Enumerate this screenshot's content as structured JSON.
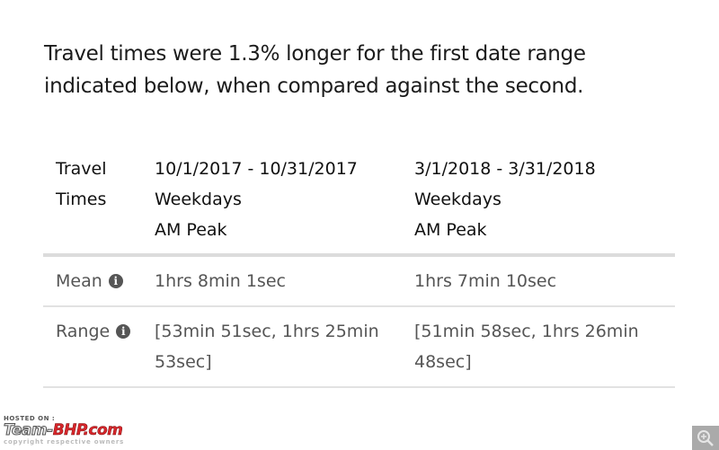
{
  "summary": "Travel times were 1.3% longer for the first date range indicated below, when compared against the second.",
  "table": {
    "header": {
      "label_line1": "Travel",
      "label_line2": "Times",
      "col1": {
        "dates": "10/1/2017 - 10/31/2017",
        "days": "Weekdays",
        "period": "AM Peak"
      },
      "col2": {
        "dates": "3/1/2018 - 3/31/2018",
        "days": "Weekdays",
        "period": "AM Peak"
      }
    },
    "rows": [
      {
        "label": "Mean",
        "icon": "info-icon",
        "col1": "1hrs 8min 1sec",
        "col2": "1hrs 7min 10sec"
      },
      {
        "label": "Range",
        "icon": "info-icon",
        "col1": "[53min 51sec, 1hrs 25min 53sec]",
        "col2": "[51min 58sec, 1hrs 26min 48sec]"
      }
    ],
    "info_glyph": "i"
  },
  "watermark": {
    "hosted": "HOSTED ON :",
    "brand_a": "Team-",
    "brand_b": "BHP.com",
    "copyright": "copyright respective owners"
  },
  "zoom_button": {
    "icon": "zoom-in-icon"
  }
}
